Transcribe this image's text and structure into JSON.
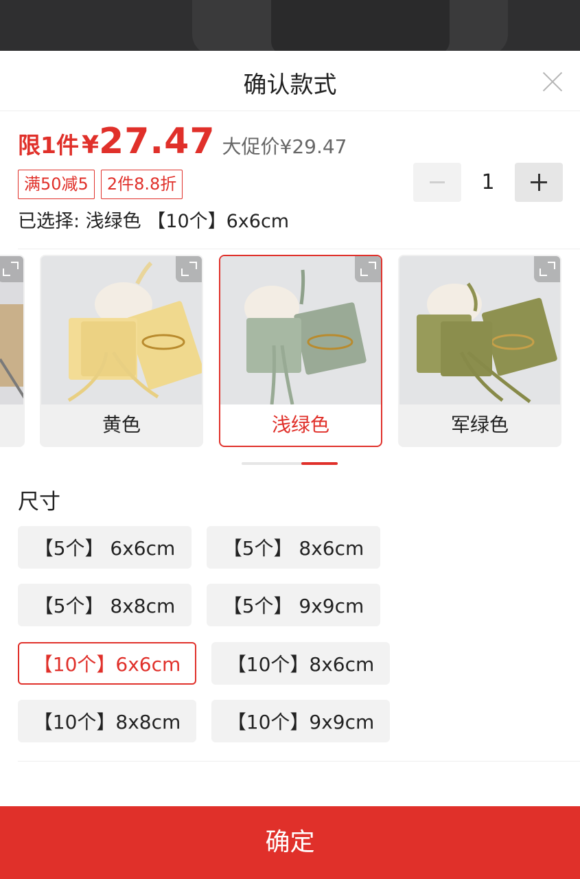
{
  "sheet": {
    "title": "确认款式"
  },
  "price": {
    "limit_label": "限1件",
    "currency": "¥",
    "value": "27.47",
    "original_label": "大促价¥29.47"
  },
  "coupons": [
    "满50减5",
    "2件8.8折"
  ],
  "quantity": {
    "value": "1"
  },
  "selected_summary": "已选择: 浅绿色 【10个】6x6cm",
  "colors": {
    "options": [
      {
        "label": "",
        "swatch": "#c9b08a"
      },
      {
        "label": "黄色",
        "swatch": "#f0d98e"
      },
      {
        "label": "浅绿色",
        "swatch": "#9fb19c"
      },
      {
        "label": "军绿色",
        "swatch": "#8e9150"
      }
    ],
    "selected": "浅绿色"
  },
  "size": {
    "title": "尺寸",
    "options": [
      "【5个】 6x6cm",
      "【5个】 8x6cm",
      "【5个】 8x8cm",
      "【5个】 9x9cm",
      "【10个】6x6cm",
      "【10个】8x6cm",
      "【10个】8x8cm",
      "【10个】9x9cm"
    ],
    "selected": "【10个】6x6cm"
  },
  "confirm_label": "确定",
  "theme": {
    "accent": "#e0302a"
  }
}
